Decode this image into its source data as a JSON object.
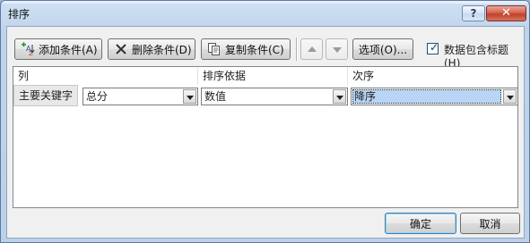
{
  "window": {
    "title": "排序",
    "help_glyph": "?",
    "close_glyph": "✕"
  },
  "toolbar": {
    "add_label": "添加条件(A)",
    "delete_label": "删除条件(D)",
    "copy_label": "复制条件(C)",
    "options_label": "选项(O)...",
    "header_checkbox_label": "数据包含标题(H)",
    "header_checkbox_checked": true
  },
  "grid": {
    "headers": {
      "column": "列",
      "sort_on": "排序依据",
      "order": "次序"
    },
    "rows": [
      {
        "label": "主要关键字",
        "column": "总分",
        "sort_on": "数值",
        "order": "降序"
      }
    ]
  },
  "footer": {
    "ok_label": "确定",
    "cancel_label": "取消"
  }
}
